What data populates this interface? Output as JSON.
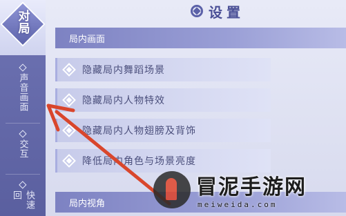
{
  "window": {
    "title": "设置"
  },
  "rail": {
    "tabs": [
      {
        "label": "对局",
        "active": true
      },
      {
        "label": "声音画面",
        "active": false
      },
      {
        "label": "交互",
        "active": false
      },
      {
        "label": "快速回",
        "active": false
      }
    ]
  },
  "main": {
    "section1": {
      "title": "局内画面"
    },
    "options": [
      {
        "label": "隐藏局内舞蹈场景"
      },
      {
        "label": "隐藏局内人物特效"
      },
      {
        "label": "隐藏局内人物翅膀及背饰"
      },
      {
        "label": "降低局内角色与场景亮度"
      }
    ],
    "section2": {
      "title": "局内视角"
    }
  },
  "annotation": {
    "arrow_color": "#d9462c"
  },
  "watermark": {
    "title": "冒泥手游网",
    "url": "meiweida.com"
  },
  "colors": {
    "rail": "#6f74b4",
    "accent": "#5b61a8",
    "header": "#7d82c2"
  }
}
